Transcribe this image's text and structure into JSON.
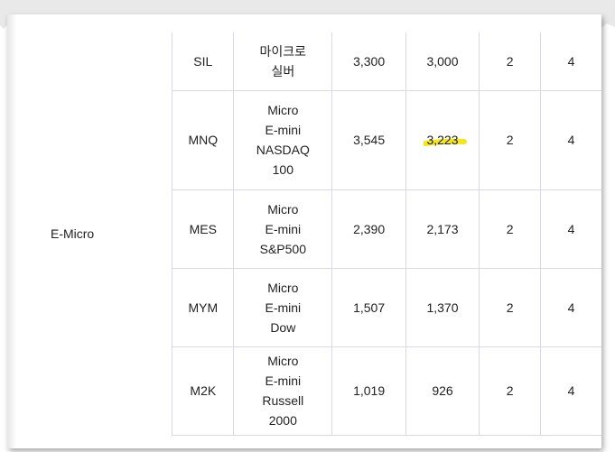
{
  "category": "E-Micro",
  "rows": [
    {
      "ticker": "SIL",
      "name_lines": [
        "마이크로",
        "실버"
      ],
      "col3": "3,300",
      "col4": "3,000",
      "col5": "2",
      "col6": "4"
    },
    {
      "ticker": "MNQ",
      "name_lines": [
        "Micro",
        "E-mini",
        "NASDAQ",
        "100"
      ],
      "col3": "3,545",
      "col4": "3,223",
      "col5": "2",
      "col6": "4",
      "highlight_col4": true
    },
    {
      "ticker": "MES",
      "name_lines": [
        "Micro",
        "E-mini",
        "S&P500"
      ],
      "col3": "2,390",
      "col4": "2,173",
      "col5": "2",
      "col6": "4"
    },
    {
      "ticker": "MYM",
      "name_lines": [
        "Micro",
        "E-mini",
        "Dow"
      ],
      "col3": "1,507",
      "col4": "1,370",
      "col5": "2",
      "col6": "4"
    },
    {
      "ticker": "M2K",
      "name_lines": [
        "Micro",
        "E-mini",
        "Russell",
        "2000"
      ],
      "col3": "1,019",
      "col4": "926",
      "col5": "2",
      "col6": "4"
    }
  ],
  "highlight_color": "#f5e61c"
}
